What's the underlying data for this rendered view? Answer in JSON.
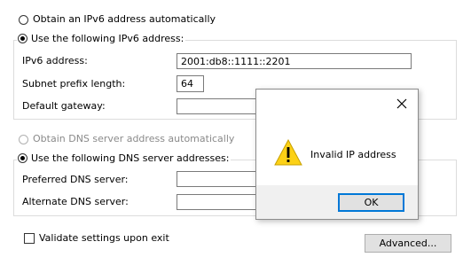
{
  "ipv6": {
    "auto_label": "Obtain an IPv6 address automatically",
    "manual_label": "Use the following IPv6 address:",
    "address_label": "IPv6 address:",
    "address_value": "2001:db8::1111::2201",
    "prefix_label": "Subnet prefix length:",
    "prefix_value": "64",
    "gateway_label": "Default gateway:",
    "gateway_value": ""
  },
  "dns": {
    "auto_label": "Obtain DNS server address automatically",
    "manual_label": "Use the following DNS server addresses:",
    "preferred_label": "Preferred DNS server:",
    "preferred_value": "",
    "alternate_label": "Alternate DNS server:",
    "alternate_value": ""
  },
  "footer": {
    "validate_label": "Validate settings upon exit",
    "advanced_label": "Advanced..."
  },
  "dialog": {
    "message": "Invalid IP address",
    "ok_label": "OK",
    "icon": "warning-icon",
    "close_icon": "close-icon"
  },
  "colors": {
    "accent": "#0078d7",
    "warning_yellow": "#fcd116",
    "dialog_footer": "#f0f0f0"
  }
}
